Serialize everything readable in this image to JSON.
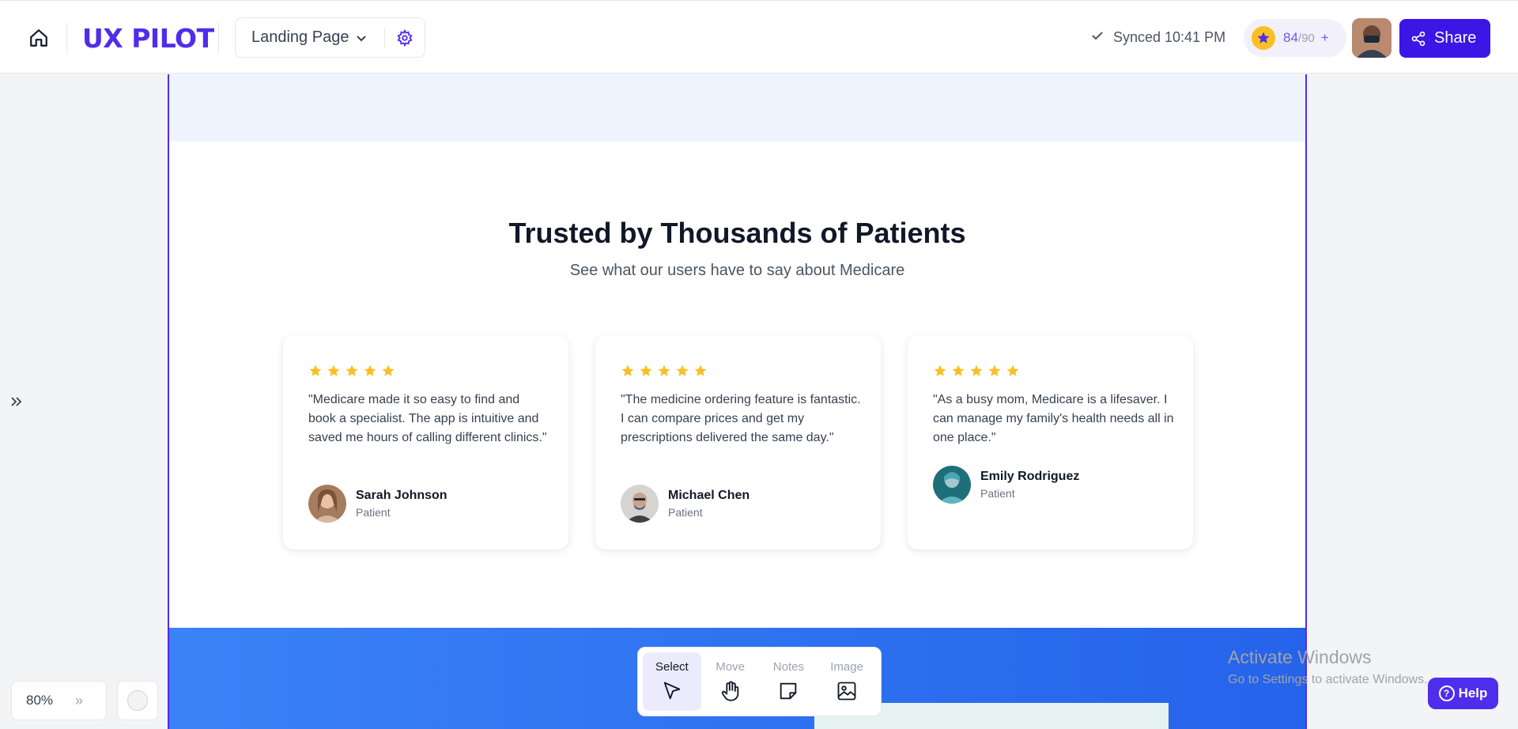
{
  "header": {
    "logo": "UX PILOT",
    "page_selector": "Landing Page",
    "synced": "Synced 10:41 PM",
    "credits_used": "84",
    "credits_total": "/90",
    "credits_plus": "+",
    "share_label": "Share"
  },
  "design": {
    "heading": "Trusted by Thousands of Patients",
    "subheading": "See what our users have to say about Medicare",
    "testimonials": [
      {
        "rating": 5,
        "quote": "\"Medicare made it so easy to find and book a specialist. The app is intuitive and saved me hours of calling different clinics.\"",
        "name": "Sarah Johnson",
        "role": "Patient"
      },
      {
        "rating": 5,
        "quote": "\"The medicine ordering feature is fantastic. I can compare prices and get my prescriptions delivered the same day.\"",
        "name": "Michael Chen",
        "role": "Patient"
      },
      {
        "rating": 5,
        "quote": "\"As a busy mom, Medicare is a lifesaver. I can manage my family's health needs all in one place.\"",
        "name": "Emily Rodriguez",
        "role": "Patient"
      }
    ]
  },
  "canvas_controls": {
    "zoom": "80%",
    "zoom_arrows": "»"
  },
  "toolbar": {
    "tools": [
      {
        "label": "Select",
        "icon": "cursor-icon",
        "active": true
      },
      {
        "label": "Move",
        "icon": "hand-icon",
        "active": false
      },
      {
        "label": "Notes",
        "icon": "note-icon",
        "active": false
      },
      {
        "label": "Image",
        "icon": "image-icon",
        "active": false
      }
    ]
  },
  "watermark": {
    "line1": "Activate Windows",
    "line2": "Go to Settings to activate Windows."
  },
  "help": {
    "label": "Help",
    "icon_glyph": "?"
  },
  "colors": {
    "brand": "#4f2dec",
    "star": "#fbbf24",
    "blue_section": "#2563eb"
  }
}
